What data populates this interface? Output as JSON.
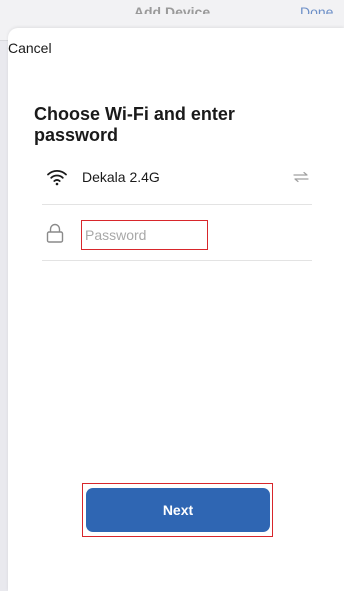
{
  "background_screen": {
    "title": "Add Device",
    "action": "Done"
  },
  "sheet": {
    "cancel_label": "Cancel",
    "heading": "Choose Wi-Fi and enter password",
    "wifi": {
      "network_name": "Dekala 2.4G",
      "icon": "wifi-icon",
      "switch_icon": "switch-network-icon"
    },
    "password": {
      "placeholder": "Password",
      "value": "",
      "icon": "lock-icon"
    },
    "next_label": "Next"
  },
  "colors": {
    "primary_button": "#2f66b3",
    "highlight_box": "#d8262b",
    "divider": "#e3e3e3"
  }
}
